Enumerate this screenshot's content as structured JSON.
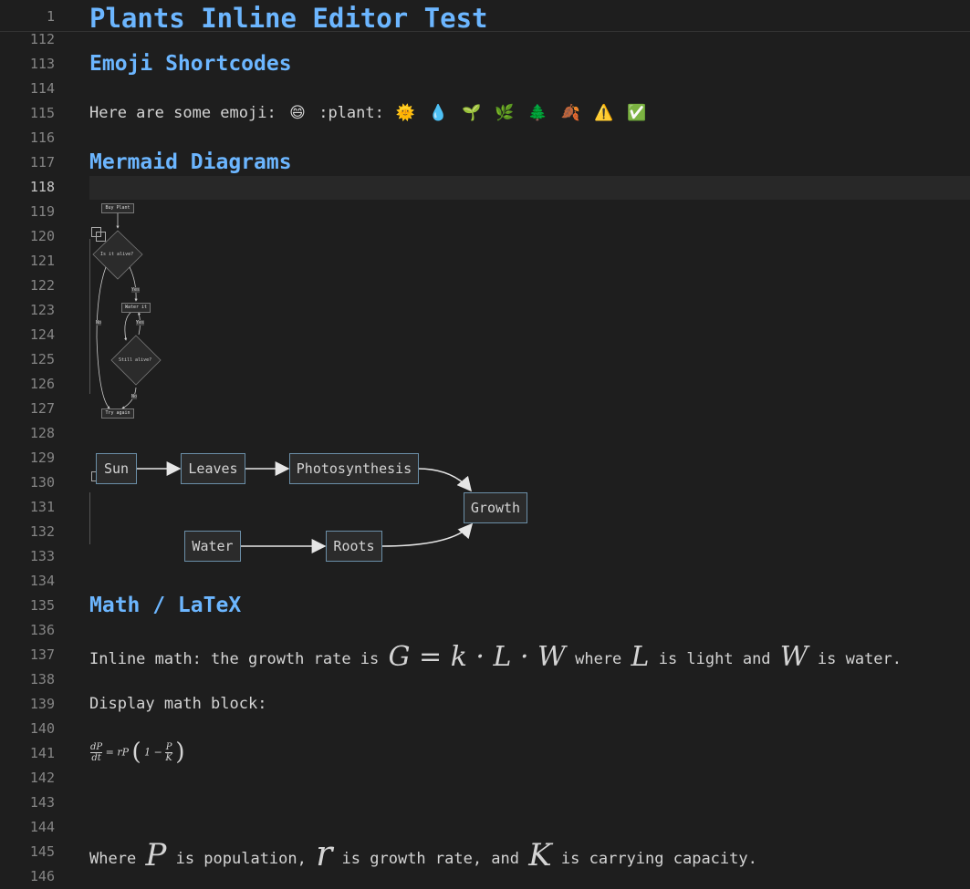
{
  "title": "Plants Inline Editor Test",
  "gutter": {
    "sticky_line": "1",
    "lines": [
      "112",
      "113",
      "114",
      "115",
      "116",
      "117",
      "118",
      "119",
      "120",
      "121",
      "122",
      "123",
      "124",
      "125",
      "126",
      "127",
      "128",
      "129",
      "130",
      "131",
      "132",
      "133",
      "134",
      "135",
      "136",
      "137",
      "138",
      "139",
      "140",
      "141",
      "142",
      "143",
      "144",
      "145",
      "146"
    ],
    "active_line": "118"
  },
  "sections": {
    "emoji_heading": "Emoji Shortcodes",
    "emoji_prefix": "Here are some emoji:",
    "emoji_shortcode": ":plant:",
    "emoji_list": [
      "😄",
      "🌞",
      "💧",
      "🌱",
      "🌿",
      "🌲",
      "🍂",
      "⚠️",
      "✅"
    ],
    "mermaid_heading": "Mermaid Diagrams",
    "math_heading": "Math / LaTeX",
    "inline_math_prefix": "Inline math: the growth rate is",
    "inline_math_formula": "G = k · L · W",
    "inline_math_mid1": "where",
    "inline_math_var_L": "L",
    "inline_math_mid2": "is light and",
    "inline_math_var_W": "W",
    "inline_math_suffix": "is water.",
    "display_math_label": "Display math block:",
    "display_math_lhs_num": "dP",
    "display_math_lhs_den": "dt",
    "display_math_rhs_prefix": "= rP",
    "display_math_one": "1 −",
    "display_math_frac_num": "P",
    "display_math_frac_den": "K",
    "where_prefix": "Where",
    "where_var_P": "P",
    "where_text1": "is population,",
    "where_var_r": "r",
    "where_text2": "is growth rate, and",
    "where_var_K": "K",
    "where_text3": "is carrying capacity."
  },
  "flowchart_small": {
    "buy_plant": "Buy Plant",
    "is_alive": "Is it alive?",
    "yes1": "Yes",
    "no1": "No",
    "water_it": "Water it",
    "yes2": "Yes",
    "still_alive": "Still alive?",
    "no2": "No",
    "try_again": "Try again"
  },
  "flowchart_large": {
    "sun": "Sun",
    "leaves": "Leaves",
    "photosynthesis": "Photosynthesis",
    "growth": "Growth",
    "water": "Water",
    "roots": "Roots"
  }
}
